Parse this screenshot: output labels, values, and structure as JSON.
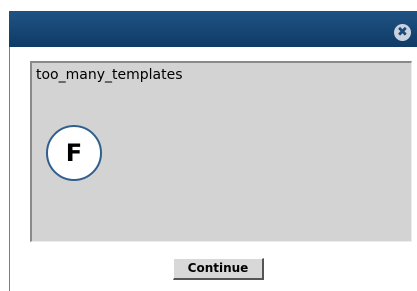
{
  "dialog": {
    "message": "too_many_templates",
    "marker_label": "F",
    "close_symbol": "✖",
    "continue_label": "Continue"
  },
  "icons": {
    "close": "close-icon"
  },
  "colors": {
    "titlebar": "#1a4c7d",
    "panel": "#d3d3d3",
    "marker_border": "#2f5f8f",
    "button": "#d8d8d8"
  }
}
